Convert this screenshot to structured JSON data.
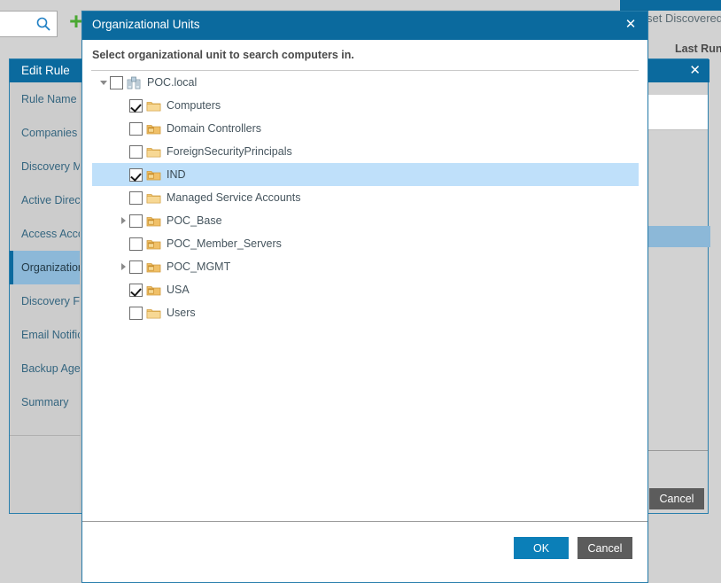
{
  "background": {
    "search": {
      "placeholder": "",
      "value": "",
      "icon": "search-icon"
    },
    "add_button": {
      "label": "+",
      "icon": "plus-icon",
      "color": "#4aa832"
    },
    "reset_discovered_text": "set Discovered Co",
    "column_header_last_run": "Last Run",
    "wizard": {
      "title": "Edit Rule",
      "close_label": "✕",
      "items": [
        {
          "label": "Rule Name",
          "selected": false
        },
        {
          "label": "Companies",
          "selected": false
        },
        {
          "label": "Discovery Me",
          "selected": false
        },
        {
          "label": "Active Directo",
          "selected": false
        },
        {
          "label": "Access Accou",
          "selected": false
        },
        {
          "label": "Organizationa",
          "selected": true
        },
        {
          "label": "Discovery Filt",
          "selected": false
        },
        {
          "label": "Email Notifica",
          "selected": false
        },
        {
          "label": "Backup Agent",
          "selected": false
        },
        {
          "label": "Summary",
          "selected": false
        }
      ],
      "cancel_label": "Cancel"
    }
  },
  "modal": {
    "title": "Organizational Units",
    "close_label": "✕",
    "subtitle": "Select organizational unit to search computers in.",
    "accent_color": "#0b6a9e",
    "highlight_color": "#bfe0fa",
    "tree": [
      {
        "label": "POC.local",
        "indent": 0,
        "twisty": "down",
        "checked": false,
        "icon": "domain-icon",
        "highlighted": false
      },
      {
        "label": "Computers",
        "indent": 1,
        "twisty": "none",
        "checked": true,
        "icon": "folder-icon",
        "highlighted": false
      },
      {
        "label": "Domain Controllers",
        "indent": 1,
        "twisty": "none",
        "checked": false,
        "icon": "ou-folder-icon",
        "highlighted": false
      },
      {
        "label": "ForeignSecurityPrincipals",
        "indent": 1,
        "twisty": "none",
        "checked": false,
        "icon": "folder-icon",
        "highlighted": false
      },
      {
        "label": "IND",
        "indent": 1,
        "twisty": "none",
        "checked": true,
        "icon": "ou-folder-icon",
        "highlighted": true
      },
      {
        "label": "Managed Service Accounts",
        "indent": 1,
        "twisty": "none",
        "checked": false,
        "icon": "folder-icon",
        "highlighted": false
      },
      {
        "label": "POC_Base",
        "indent": 1,
        "twisty": "right",
        "checked": false,
        "icon": "ou-folder-icon",
        "highlighted": false
      },
      {
        "label": "POC_Member_Servers",
        "indent": 1,
        "twisty": "none",
        "checked": false,
        "icon": "ou-folder-icon",
        "highlighted": false
      },
      {
        "label": "POC_MGMT",
        "indent": 1,
        "twisty": "right",
        "checked": false,
        "icon": "ou-folder-icon",
        "highlighted": false
      },
      {
        "label": "USA",
        "indent": 1,
        "twisty": "none",
        "checked": true,
        "icon": "ou-folder-icon",
        "highlighted": false
      },
      {
        "label": "Users",
        "indent": 1,
        "twisty": "none",
        "checked": false,
        "icon": "folder-icon",
        "highlighted": false
      }
    ],
    "footer": {
      "ok_label": "OK",
      "cancel_label": "Cancel"
    }
  }
}
